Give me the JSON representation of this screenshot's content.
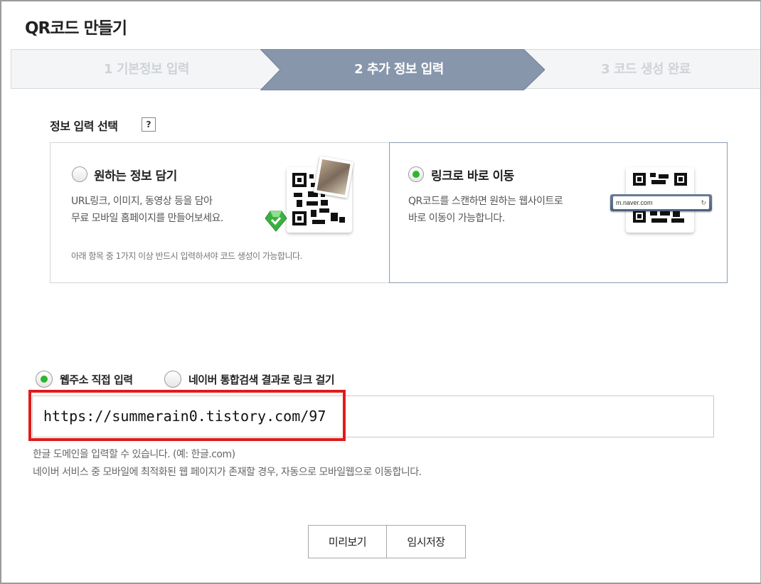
{
  "page": {
    "title": "QR코드 만들기"
  },
  "steps": [
    {
      "label": "1 기본정보 입력",
      "state": "done"
    },
    {
      "label": "2 추가 정보 입력",
      "state": "active"
    },
    {
      "label": "3 코드 생성 완료",
      "state": "pending"
    }
  ],
  "info_select": {
    "label": "정보 입력 선택",
    "help": "?"
  },
  "options": [
    {
      "title": "원하는 정보 담기",
      "desc_line1": "URL링크, 이미지, 동영상 등을 담아",
      "desc_line2": "무료 모바일 홈페이지를 만들어보세요.",
      "note": "아래 항목 중 1가지 이상 반드시 입력하셔야 코드 생성이 가능합니다.",
      "selected": false
    },
    {
      "title": "링크로 바로 이동",
      "desc_line1": "QR코드를 스캔하면 원하는 웹사이트로",
      "desc_line2": "바로 이동이 가능합니다.",
      "address_bar": "m.naver.com",
      "selected": true
    }
  ],
  "link_type": {
    "direct_label": "웹주소 직접 입력",
    "naver_label": "네이버 통합검색 결과로 링크 걸기",
    "selected": "direct"
  },
  "url_field": {
    "value": "https://summerain0.tistory.com/97"
  },
  "hints": {
    "line1": "한글 도메인을 입력할 수 있습니다. (예: 한글.com)",
    "line2": "네이버 서비스 중 모바일에 최적화된 웹 페이지가 존재할 경우, 자동으로 모바일웹으로 이동합니다."
  },
  "buttons": {
    "preview": "미리보기",
    "temp_save": "임시저장"
  },
  "colors": {
    "active_step": "#8796ab",
    "radio_on": "#2fb52f",
    "highlight": "#e11b1b"
  }
}
